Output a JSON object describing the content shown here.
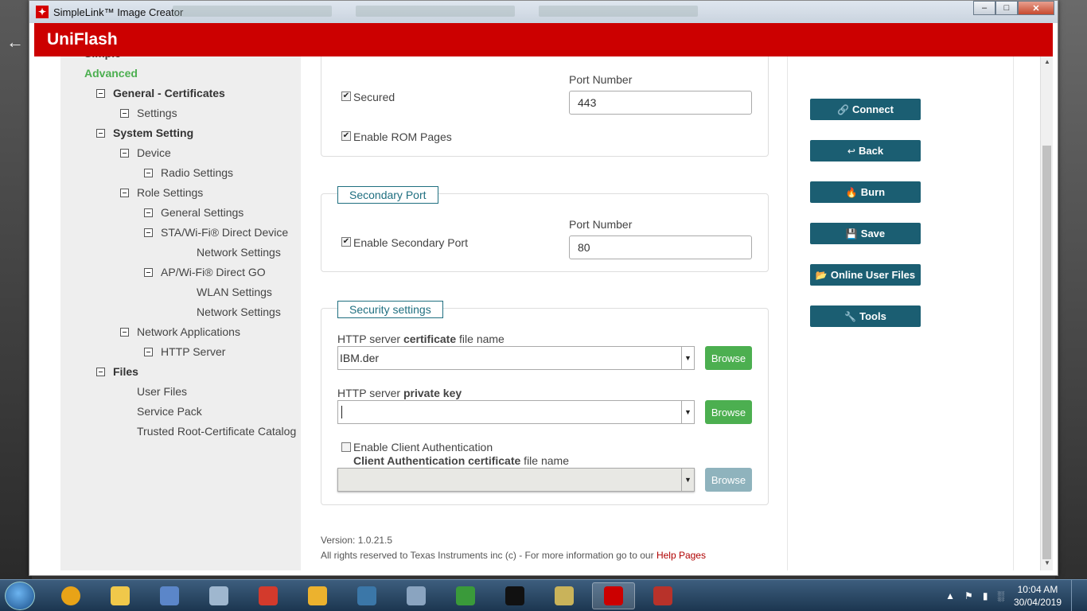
{
  "window": {
    "title": "SimpleLink™ Image Creator",
    "minimize": "–",
    "maximize": "□",
    "close": "✕"
  },
  "app": {
    "header": "UniFlash"
  },
  "sidebar": {
    "items": [
      {
        "label": "Simple",
        "level": 0,
        "style": "partial"
      },
      {
        "label": "Advanced",
        "level": 0,
        "style": "green"
      },
      {
        "label": "General - Certificates",
        "level": 1,
        "style": "bold",
        "toggle": true
      },
      {
        "label": "Settings",
        "level": 2,
        "toggle": true
      },
      {
        "label": "System Setting",
        "level": 1,
        "style": "bold",
        "toggle": true
      },
      {
        "label": "Device",
        "level": 2,
        "toggle": true
      },
      {
        "label": "Radio Settings",
        "level": 3,
        "toggle": true
      },
      {
        "label": "Role Settings",
        "level": 2,
        "toggle": true
      },
      {
        "label": "General Settings",
        "level": 3,
        "toggle": true
      },
      {
        "label": "STA/Wi-Fi® Direct Device",
        "level": 3,
        "toggle": true
      },
      {
        "label": "Network Settings",
        "level": 4
      },
      {
        "label": "AP/Wi-Fi® Direct GO",
        "level": 3,
        "toggle": true
      },
      {
        "label": "WLAN Settings",
        "level": 4
      },
      {
        "label": "Network Settings",
        "level": 4
      },
      {
        "label": "Network Applications",
        "level": 2,
        "toggle": true
      },
      {
        "label": "HTTP Server",
        "level": 3,
        "toggle": true
      },
      {
        "label": "Files",
        "level": 1,
        "style": "bold",
        "toggle": true
      },
      {
        "label": "User Files",
        "level": 2
      },
      {
        "label": "Service Pack",
        "level": 2
      },
      {
        "label": "Trusted Root-Certificate Catalog",
        "level": 2
      }
    ]
  },
  "primary_port": {
    "secured_label": "Secured",
    "secured_checked": true,
    "port_label": "Port Number",
    "port_value": "443",
    "rom_label": "Enable ROM Pages",
    "rom_checked": true
  },
  "secondary_port": {
    "legend": "Secondary Port",
    "enable_label": "Enable Secondary Port",
    "enable_checked": true,
    "port_label": "Port Number",
    "port_value": "80"
  },
  "security": {
    "legend": "Security settings",
    "cert_label_pre": "HTTP server ",
    "cert_label_bold": "certificate",
    "cert_label_post": " file name",
    "cert_value": "IBM.der",
    "key_label_pre": "HTTP server ",
    "key_label_bold": "private key",
    "key_value": "",
    "client_auth_label": "Enable Client Authentication",
    "client_auth_checked": false,
    "client_cert_label_bold": "Client Authentication certificate",
    "client_cert_label_post": " file name",
    "client_cert_value": "",
    "browse_label": "Browse"
  },
  "footer": {
    "version": "Version: 1.0.21.5",
    "rights": "All rights reserved to Texas Instruments inc (c) - For more information go to our ",
    "help_link": "Help Pages"
  },
  "actions": [
    {
      "label": "Connect",
      "icon": "link-icon",
      "glyph": "🔗"
    },
    {
      "label": "Back",
      "icon": "back-icon",
      "glyph": "↩"
    },
    {
      "label": "Burn",
      "icon": "flame-icon",
      "glyph": "🔥"
    },
    {
      "label": "Save",
      "icon": "floppy-icon",
      "glyph": "💾"
    },
    {
      "label": "Online User Files",
      "icon": "folder-icon",
      "glyph": "📂"
    },
    {
      "label": "Tools",
      "icon": "wrench-icon",
      "glyph": "🔧"
    }
  ],
  "taskbar": {
    "time": "10:04 AM",
    "date": "30/04/2019",
    "apps": [
      {
        "icon": "chrome-icon",
        "color": "#e8a317"
      },
      {
        "icon": "file-explorer-icon",
        "color": "#f0c84a"
      },
      {
        "icon": "network-tool-icon",
        "color": "#5b86c9"
      },
      {
        "icon": "calculator-icon",
        "color": "#9fb7cf"
      },
      {
        "icon": "office-icon",
        "color": "#d33a2c"
      },
      {
        "icon": "slack-icon",
        "color": "#ecb22e"
      },
      {
        "icon": "python-icon",
        "color": "#3b77a8"
      },
      {
        "icon": "device-icon",
        "color": "#8aa4c0"
      },
      {
        "icon": "network-icon",
        "color": "#3a9a3a"
      },
      {
        "icon": "terminal-icon",
        "color": "#111111"
      },
      {
        "icon": "tool-icon",
        "color": "#c9b35a"
      },
      {
        "icon": "uniflash-icon",
        "color": "#cc0000",
        "active": true
      },
      {
        "icon": "toolbox-icon",
        "color": "#b8322a"
      }
    ]
  },
  "colors": {
    "brand_red": "#cc0000",
    "action_teal": "#1b5e72",
    "browse_green": "#4caf50"
  }
}
